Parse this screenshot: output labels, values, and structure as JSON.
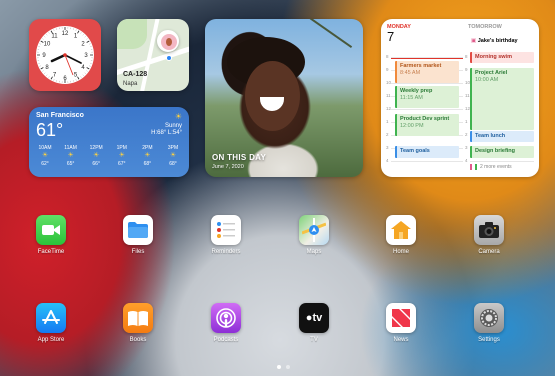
{
  "maps_widget": {
    "location": "CA-128",
    "area": "Napa"
  },
  "photo_widget": {
    "title": "ON THIS DAY",
    "date": "June 7, 2020"
  },
  "weather_widget": {
    "city": "San Francisco",
    "temp": "61°",
    "condition": "Sunny",
    "high_low": "H:68° L:54°",
    "hours": [
      {
        "time": "10AM",
        "temp": "62°"
      },
      {
        "time": "11AM",
        "temp": "65°"
      },
      {
        "time": "12PM",
        "temp": "66°"
      },
      {
        "time": "1PM",
        "temp": "67°"
      },
      {
        "time": "2PM",
        "temp": "68°"
      },
      {
        "time": "3PM",
        "temp": "68°"
      }
    ]
  },
  "calendar_widget": {
    "today": {
      "dayname": "MONDAY",
      "daynum": "7"
    },
    "tomorrow": {
      "dayname": "TOMORROW"
    },
    "birthday": "Jake's birthday",
    "hour_labels": [
      "8",
      "9",
      "10",
      "11",
      "12",
      "1",
      "2",
      "3",
      "4"
    ],
    "today_events": [
      {
        "title": "Farmers market",
        "time": "8:45 AM"
      },
      {
        "title": "Weekly prep",
        "time": "11:15 AM"
      },
      {
        "title": "Product Dev sprint",
        "time": "12:00 PM"
      },
      {
        "title": "Team goals",
        "time": ""
      }
    ],
    "tomorrow_events": [
      {
        "title": "Morning swim",
        "time": ""
      },
      {
        "title": "Project Ariel",
        "time": "10:00 AM"
      },
      {
        "title": "Team lunch",
        "time": ""
      },
      {
        "title": "Design briefing",
        "time": ""
      }
    ],
    "more": "2 more events"
  },
  "apps": [
    {
      "name": "FaceTime",
      "icon": "facetime-icon"
    },
    {
      "name": "Files",
      "icon": "files-icon"
    },
    {
      "name": "Reminders",
      "icon": "reminders-icon"
    },
    {
      "name": "Maps",
      "icon": "maps-icon"
    },
    {
      "name": "Home",
      "icon": "home-icon"
    },
    {
      "name": "Camera",
      "icon": "camera-icon"
    },
    {
      "name": "App Store",
      "icon": "appstore-icon"
    },
    {
      "name": "Books",
      "icon": "books-icon"
    },
    {
      "name": "Podcasts",
      "icon": "podcasts-icon"
    },
    {
      "name": "TV",
      "icon": "tv-icon"
    },
    {
      "name": "News",
      "icon": "news-icon"
    },
    {
      "name": "Settings",
      "icon": "settings-icon"
    }
  ],
  "tv_icon_text": "tv",
  "page_dots": {
    "count": 2,
    "active": 0
  }
}
